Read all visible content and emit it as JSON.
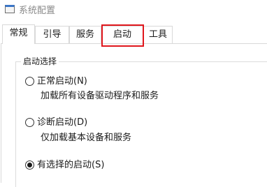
{
  "window": {
    "title": "系统配置",
    "icon": "msconfig-icon"
  },
  "tabs": [
    {
      "label": "常规",
      "active": true
    },
    {
      "label": "引导",
      "active": false
    },
    {
      "label": "服务",
      "active": false
    },
    {
      "label": "启动",
      "active": false,
      "highlighted": true
    },
    {
      "label": "工具",
      "active": false
    }
  ],
  "startup_selection": {
    "legend": "启动选择",
    "options": [
      {
        "label": "正常启动(N)",
        "description": "加载所有设备驱动程序和服务",
        "selected": false
      },
      {
        "label": "诊断启动(D)",
        "description": "仅加载基本设备和服务",
        "selected": false
      },
      {
        "label": "有选择的启动(S)",
        "selected": true
      }
    ]
  },
  "colors": {
    "highlight_box": "#e0161c",
    "border": "#d9d9d9",
    "title_text": "#8a8a8a"
  }
}
